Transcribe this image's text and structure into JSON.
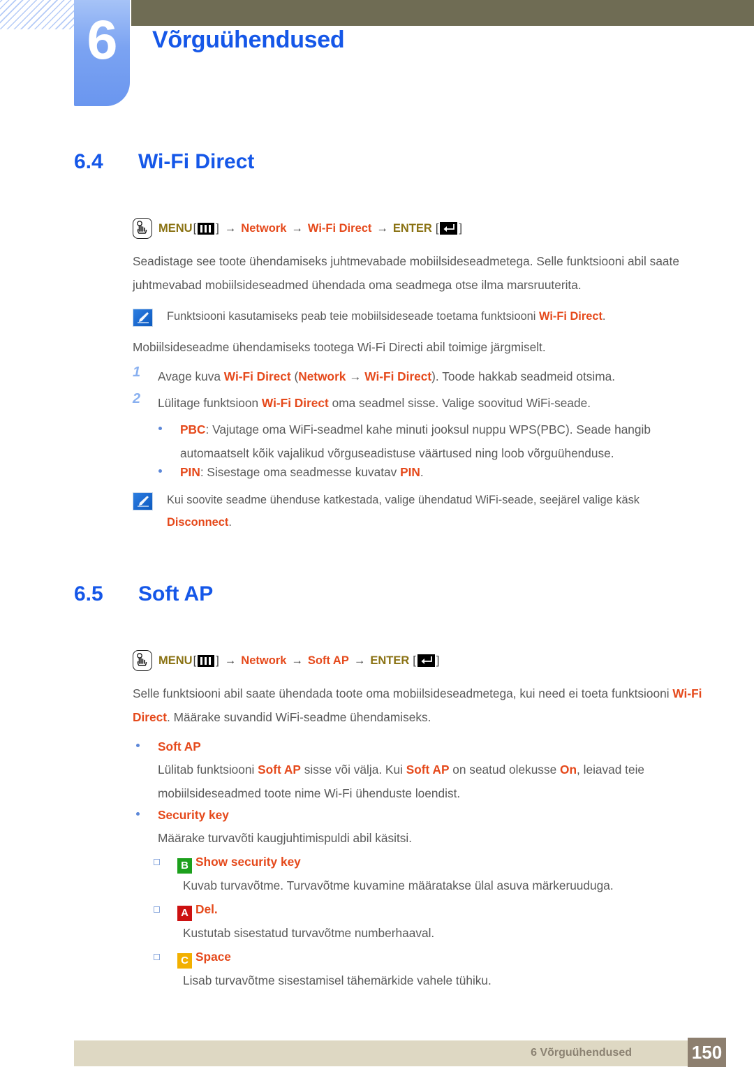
{
  "header": {
    "chapter_number": "6",
    "chapter_title": "Võrguühendused"
  },
  "sections": [
    {
      "number": "6.4",
      "title": "Wi-Fi Direct",
      "menu_path": {
        "menu_label": "MENU",
        "menu_glyph": "menu-bars-icon",
        "arrow": "→",
        "step1": "Network",
        "step2": "Wi-Fi Direct",
        "enter_label": "ENTER",
        "enter_glyph": "enter-return-icon",
        "bracket_open": "[",
        "bracket_close": "]"
      },
      "intro": "Seadistage see toote ühendamiseks juhtmevabade mobiilsideseadmetega. Selle funktsiooni abil saate juhtmevabad mobiilsideseadmed ühendada oma seadmega otse ilma marsruuterita.",
      "note1": {
        "text_before": "Funktsiooni kasutamiseks peab teie mobiilsideseade toetama funktsiooni ",
        "highlight": "Wi-Fi Direct",
        "text_after": "."
      },
      "lead_in": "Mobiilsideseadme ühendamiseks tootega Wi-Fi Directi abil toimige järgmiselt.",
      "steps": [
        {
          "marker": "1",
          "t1": "Avage kuva ",
          "h1": "Wi-Fi Direct",
          "t2": " (",
          "h2": "Network",
          "t3": " → ",
          "h3": "Wi-Fi Direct",
          "t4": "). Toode hakkab seadmeid otsima."
        },
        {
          "marker": "2",
          "t1": "Lülitage funktsioon ",
          "h1": "Wi-Fi Direct",
          "t2": " oma seadmel sisse. Valige soovitud WiFi-seade.",
          "h2": "",
          "t3": "",
          "h3": "",
          "t4": ""
        }
      ],
      "bullets": [
        {
          "label": "PBC",
          "text": ": Vajutage oma WiFi-seadmel kahe minuti jooksul nuppu WPS(PBC). Seade hangib automaatselt kõik vajalikud võrguseadistuse väärtused ning loob võrguühenduse."
        },
        {
          "label": "PIN",
          "text_before": ": Sisestage oma seadmesse kuvatav ",
          "label2": "PIN",
          "text_after": "."
        }
      ],
      "note2": {
        "text_before": "Kui soovite seadme ühenduse katkestada, valige ühendatud WiFi-seade, seejärel valige käsk ",
        "highlight": "Disconnect",
        "text_after": "."
      }
    },
    {
      "number": "6.5",
      "title": "Soft AP",
      "menu_path": {
        "menu_label": "MENU",
        "menu_glyph": "menu-bars-icon",
        "arrow": "→",
        "step1": "Network",
        "step2": "Soft AP",
        "enter_label": "ENTER",
        "enter_glyph": "enter-return-icon",
        "bracket_open": "[",
        "bracket_close": "]"
      },
      "intro_t1": "Selle funktsiooni abil saate ühendada toote oma mobiilsideseadmetega, kui need ei toeta funktsiooni ",
      "intro_h1": "Wi-Fi Direct",
      "intro_t2": ". Määrake suvandid WiFi-seadme ühendamiseks.",
      "options": [
        {
          "name": "Soft AP",
          "desc_t1": "Lülitab funktsiooni ",
          "desc_h1": "Soft AP",
          "desc_t2": " sisse või välja. Kui ",
          "desc_h2": "Soft AP",
          "desc_t3": " on seatud olekusse ",
          "desc_h3": "On",
          "desc_t4": ", leiavad teie mobiilsideseadmed toote nime Wi-Fi ühenduste loendist."
        },
        {
          "name": "Security key",
          "desc_t1": "Määrake turvavõti kaugjuhtimispuldi abil käsitsi."
        }
      ],
      "key_items": [
        {
          "badge": "B",
          "badge_color": "#1ca01c",
          "label": "Show security key",
          "desc": "Kuvab turvavõtme. Turvavõtme kuvamine määratakse ülal asuva märkeruuduga."
        },
        {
          "badge": "A",
          "badge_color": "#cc1111",
          "label": "Del.",
          "desc": "Kustutab sisestatud turvavõtme numberhaaval."
        },
        {
          "badge": "C",
          "badge_color": "#f2b000",
          "label": "Space",
          "desc": "Lisab turvavõtme sisestamisel tähemärkide vahele tühiku."
        }
      ]
    }
  ],
  "footer": {
    "chapter_ref": "6 Võrguühendused",
    "page_number": "150"
  }
}
